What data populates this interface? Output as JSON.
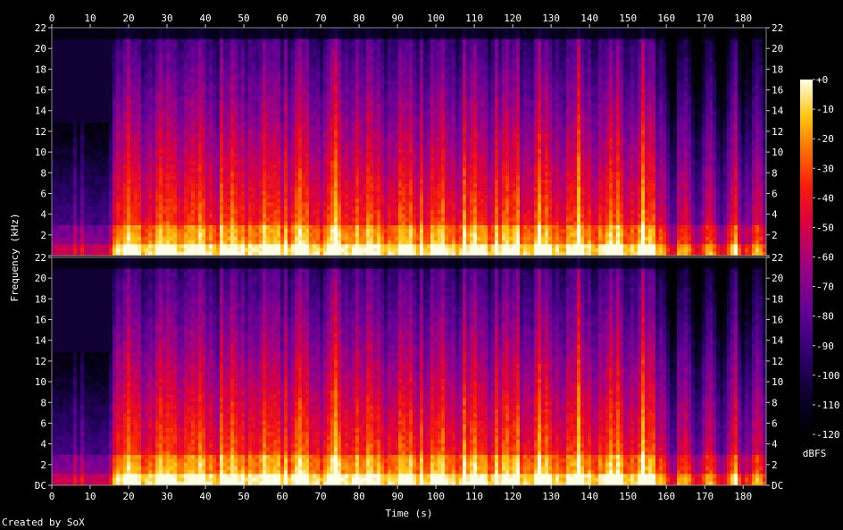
{
  "chart_data": {
    "type": "heatmap",
    "title": "",
    "xlabel": "Time (s)",
    "ylabel": "Frequency (kHz)",
    "xlim": [
      0,
      186
    ],
    "ylim": [
      0,
      22
    ],
    "x_ticks": [
      0,
      10,
      20,
      30,
      40,
      50,
      60,
      70,
      80,
      90,
      100,
      110,
      120,
      130,
      140,
      150,
      160,
      170,
      180
    ],
    "y_ticks": [
      {
        "value": 0,
        "label": "DC"
      },
      {
        "value": 2,
        "label": "2"
      },
      {
        "value": 4,
        "label": "4"
      },
      {
        "value": 6,
        "label": "6"
      },
      {
        "value": 8,
        "label": "8"
      },
      {
        "value": 10,
        "label": "10"
      },
      {
        "value": 12,
        "label": "12"
      },
      {
        "value": 14,
        "label": "14"
      },
      {
        "value": 16,
        "label": "16"
      },
      {
        "value": 18,
        "label": "18"
      },
      {
        "value": 20,
        "label": "20"
      },
      {
        "value": 22,
        "label": "22"
      }
    ],
    "channels": 2,
    "colorbar": {
      "label": "dBFS",
      "range": [
        -120,
        0
      ],
      "ticks": [
        {
          "value": 0,
          "label": "+0"
        },
        {
          "value": -10,
          "label": "-10"
        },
        {
          "value": -20,
          "label": "-20"
        },
        {
          "value": -30,
          "label": "-30"
        },
        {
          "value": -40,
          "label": "-40"
        },
        {
          "value": -50,
          "label": "-50"
        },
        {
          "value": -60,
          "label": "-60"
        },
        {
          "value": -70,
          "label": "-70"
        },
        {
          "value": -80,
          "label": "-80"
        },
        {
          "value": -90,
          "label": "-90"
        },
        {
          "value": -100,
          "label": "-100"
        },
        {
          "value": -110,
          "label": "-110"
        },
        {
          "value": -120,
          "label": "-120"
        }
      ]
    }
  },
  "footer": {
    "credit": "Created by SoX"
  }
}
